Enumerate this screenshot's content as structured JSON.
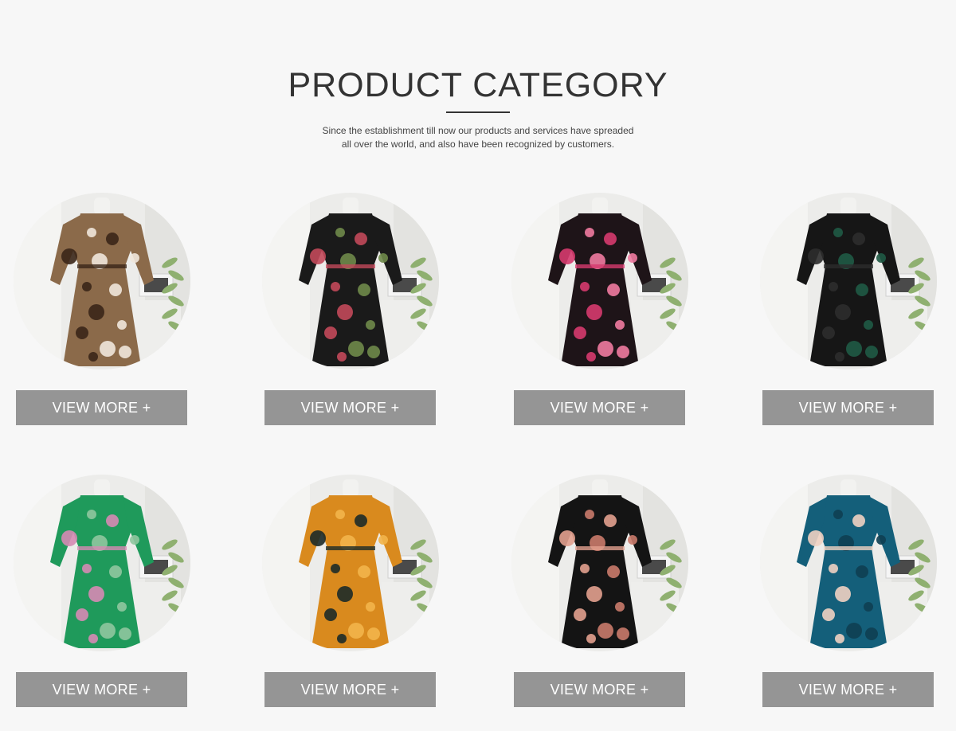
{
  "header": {
    "title": "PRODUCT CATEGORY",
    "subtitle_line1": "Since the establishment till now our products and services have spreaded",
    "subtitle_line2": "all over the world, and also have been recognized by customers."
  },
  "products": [
    {
      "button": "VIEW MORE +",
      "image": "leopard-stripe-pleated-dress-photo",
      "colors": {
        "main": "#8b6a4a",
        "accent": "#3a2618",
        "trim": "#efe7dc"
      }
    },
    {
      "button": "VIEW MORE +",
      "image": "black-bodysuit-embroidered-mesh-photo",
      "colors": {
        "main": "#1a1a1a",
        "accent": "#c2495a",
        "trim": "#6f8a4a"
      }
    },
    {
      "button": "VIEW MORE +",
      "image": "pink-rose-print-shirt-dress-photo",
      "colors": {
        "main": "#1e1418",
        "accent": "#d63a6e",
        "trim": "#f07aa0"
      }
    },
    {
      "button": "VIEW MORE +",
      "image": "black-wrap-pleated-maxi-dress-photo",
      "colors": {
        "main": "#161616",
        "accent": "#2c2c2c",
        "trim": "#1f5a45"
      }
    },
    {
      "button": "VIEW MORE +",
      "image": "green-floral-shirt-dress-photo",
      "colors": {
        "main": "#1f9a5b",
        "accent": "#d68ab4",
        "trim": "#8fc79e"
      }
    },
    {
      "button": "VIEW MORE +",
      "image": "orange-tropical-print-maxi-dress-photo",
      "colors": {
        "main": "#d98a1e",
        "accent": "#1c2a28",
        "trim": "#f2b44a"
      }
    },
    {
      "button": "VIEW MORE +",
      "image": "black-pink-floral-wrap-dress-photo",
      "colors": {
        "main": "#141414",
        "accent": "#e2a08e",
        "trim": "#c97a6a"
      }
    },
    {
      "button": "VIEW MORE +",
      "image": "teal-abstract-print-dress-photo",
      "colors": {
        "main": "#145f7a",
        "accent": "#efd2c2",
        "trim": "#0e3f52"
      }
    }
  ]
}
